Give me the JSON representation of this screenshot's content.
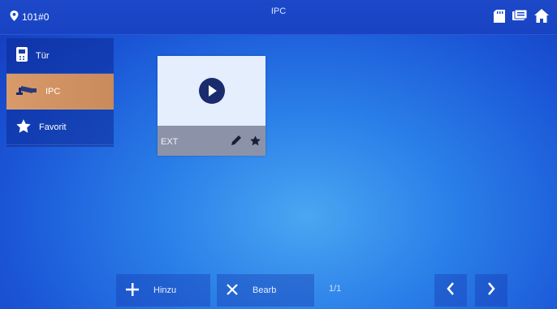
{
  "header": {
    "room": "101#0",
    "title": "IPC"
  },
  "sidebar": {
    "items": [
      {
        "label": "Tür",
        "icon": "door-phone-icon"
      },
      {
        "label": "IPC",
        "icon": "camera-icon"
      },
      {
        "label": "Favorit",
        "icon": "star-icon"
      }
    ],
    "active_index": 1
  },
  "cameras": [
    {
      "name": "EXT"
    }
  ],
  "toolbar": {
    "add_label": "Hinzu",
    "edit_label": "Bearb",
    "page": "1/1"
  },
  "colors": {
    "active_tab": "#d99a6a",
    "background": "#2a7ee8",
    "topbar": "#1c48c9"
  }
}
